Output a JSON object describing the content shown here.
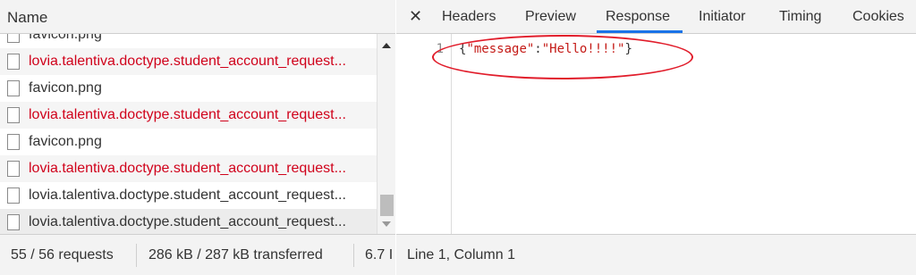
{
  "left_panel": {
    "header": "Name",
    "rows": [
      {
        "label": "favicon.png",
        "kind": "ok"
      },
      {
        "label": "lovia.talentiva.doctype.student_account_request...",
        "kind": "err"
      },
      {
        "label": "favicon.png",
        "kind": "ok"
      },
      {
        "label": "lovia.talentiva.doctype.student_account_request...",
        "kind": "err"
      },
      {
        "label": "favicon.png",
        "kind": "ok"
      },
      {
        "label": "lovia.talentiva.doctype.student_account_request...",
        "kind": "err"
      },
      {
        "label": "lovia.talentiva.doctype.student_account_request...",
        "kind": "ok"
      },
      {
        "label": "lovia.talentiva.doctype.student_account_request...",
        "kind": "ok"
      }
    ],
    "status": {
      "requests": "55 / 56 requests",
      "transferred": "286 kB / 287 kB transferred",
      "resources": "6.7 I"
    }
  },
  "right_panel": {
    "tabs": [
      "Headers",
      "Preview",
      "Response",
      "Initiator",
      "Timing",
      "Cookies"
    ],
    "active_tab": "Response",
    "editor": {
      "line_number": "1",
      "brace_open": "{",
      "key": "\"message\"",
      "colon": ":",
      "value": "\"Hello!!!!\"",
      "brace_close": "}"
    },
    "cursor_position": "Line 1, Column 1"
  },
  "colors": {
    "error_text": "#d0021b",
    "accent": "#1a73e8",
    "annotation": "#e11d2b"
  }
}
